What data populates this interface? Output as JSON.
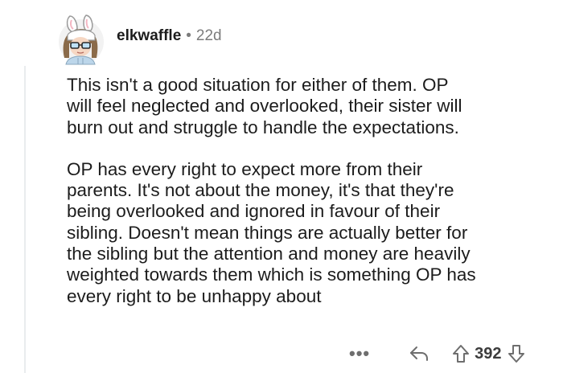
{
  "comment": {
    "username": "elkwaffle",
    "separator": "•",
    "age": "22d",
    "paragraphs": [
      "This isn't a good situation for either of them. OP\nwill feel neglected and overlooked, their sister will\nburn out and struggle to handle the expectations.",
      "OP has every right to expect more from their\nparents. It's not about the money, it's that they're\nbeing overlooked and ignored in favour of their\nsibling. Doesn't mean things are actually better for\nthe sibling but the attention and money are heavily\nweighted towards them which is something OP has\nevery right to be unhappy about"
    ],
    "actions": {
      "more_label": "•••",
      "score": "392"
    }
  },
  "icons": {
    "avatar": "bunny-avatar-icon",
    "more": "more-options-icon",
    "reply": "reply-arrow-icon",
    "upvote": "upvote-arrow-icon",
    "downvote": "downvote-arrow-icon"
  },
  "colors": {
    "text": "#1c1c1c",
    "meta": "#7c7c7c",
    "icon": "#6e6e6e",
    "thread_line": "#e9ecee"
  }
}
